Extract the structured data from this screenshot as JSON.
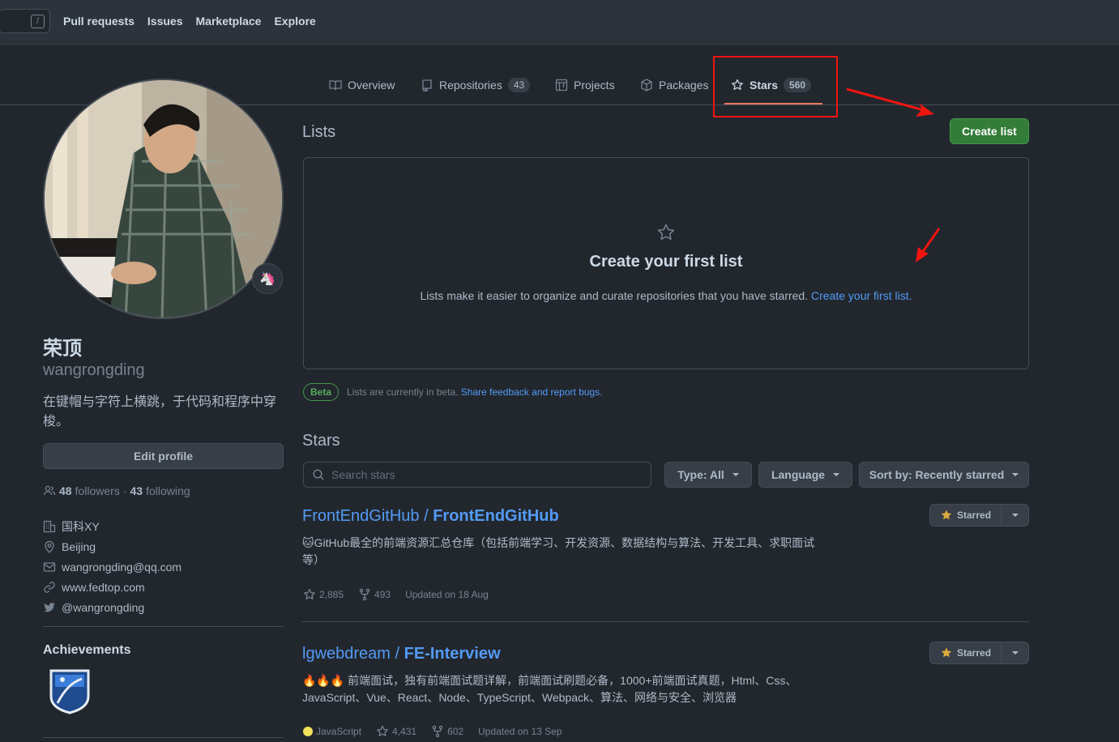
{
  "header": {
    "slash_key": "/",
    "nav": [
      "Pull requests",
      "Issues",
      "Marketplace",
      "Explore"
    ]
  },
  "tabs": [
    {
      "label": "Overview",
      "icon": "book-icon"
    },
    {
      "label": "Repositories",
      "count": "43",
      "icon": "repo-icon"
    },
    {
      "label": "Projects",
      "icon": "project-icon"
    },
    {
      "label": "Packages",
      "icon": "package-icon"
    },
    {
      "label": "Stars",
      "count": "560",
      "icon": "star-icon",
      "active": true
    }
  ],
  "profile": {
    "name": "荣顶",
    "login": "wangrongding",
    "bio": "在键帽与字符上横跳，于代码和程序中穿梭。",
    "status_emoji": "🦄",
    "edit_label": "Edit profile",
    "followers": "48",
    "followers_label": "followers",
    "dot": "·",
    "following": "43",
    "following_label": "following",
    "company": "国科XY",
    "location": "Beijing",
    "email": "wangrongding@qq.com",
    "website": "www.fedtop.com",
    "twitter": "@wangrongding",
    "achievements_title": "Achievements"
  },
  "lists": {
    "title": "Lists",
    "create_label": "Create list",
    "blank_title": "Create your first list",
    "blank_desc": "Lists make it easier to organize and curate repositories that you have starred.",
    "blank_link": "Create your first list.",
    "beta_label": "Beta",
    "beta_text": "Lists are currently in beta.",
    "beta_link": "Share feedback and report bugs."
  },
  "stars": {
    "title": "Stars",
    "search_placeholder": "Search stars",
    "filters": [
      "Type: All",
      "Language",
      "Sort by: Recently starred"
    ],
    "starred_label": "Starred",
    "repos": [
      {
        "owner": "FrontEndGitHub",
        "sep": " / ",
        "name": "FrontEndGitHub",
        "desc": "🐱GitHub最全的前端资源汇总仓库（包括前端学习、开发资源、数据结构与算法、开发工具、求职面试等）",
        "stars": "2,885",
        "forks": "493",
        "updated": "Updated on 18 Aug"
      },
      {
        "owner": "lgwebdream",
        "sep": " / ",
        "name": "FE-Interview",
        "desc": "🔥🔥🔥 前端面试，独有前端面试题详解，前端面试刷题必备，1000+前端面试真题，Html、Css、JavaScript、Vue、React、Node、TypeScript、Webpack、算法、网络与安全、浏览器",
        "language": "JavaScript",
        "language_color": "#f1e05a",
        "stars": "4,431",
        "forks": "602",
        "updated": "Updated on 13 Sep"
      }
    ]
  },
  "colors": {
    "accent": "#539bf5",
    "create_button": "#347d39",
    "annotation_red": "#f2150f",
    "active_underline": "#ec775c"
  }
}
